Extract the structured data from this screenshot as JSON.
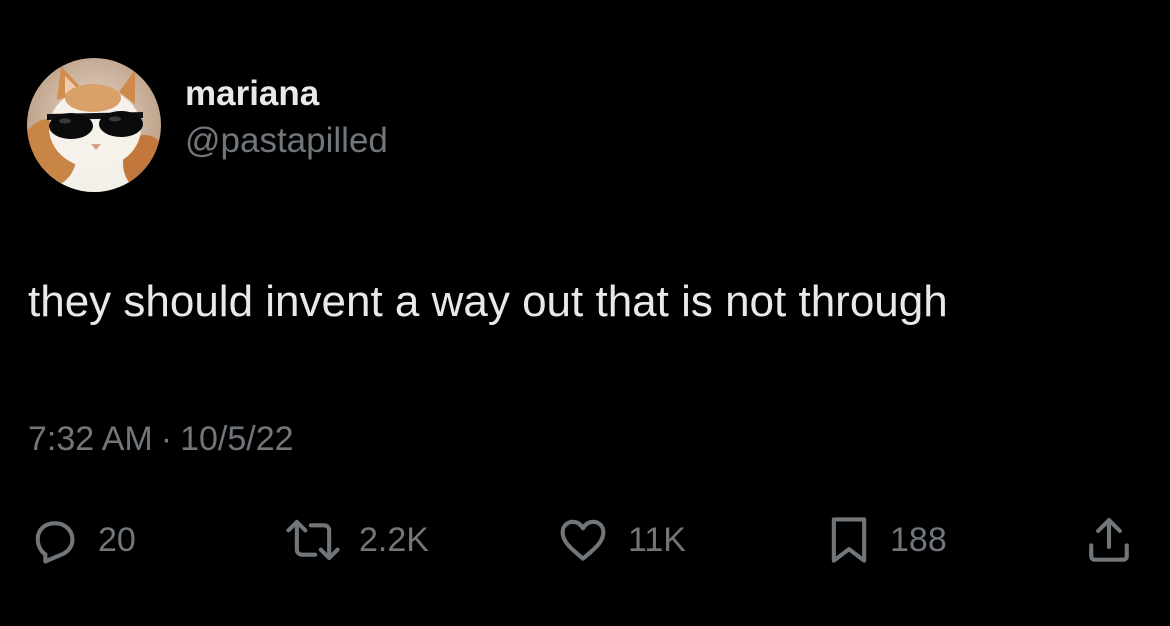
{
  "author": {
    "display_name": "mariana",
    "handle": "@pastapilled",
    "avatar_icon": "cat-with-sunglasses-avatar"
  },
  "tweet": {
    "text": "they should invent a way out that is not through",
    "time": "7:32 AM",
    "separator": "·",
    "date": "10/5/22"
  },
  "actions": {
    "reply": {
      "icon": "reply-icon",
      "count": "20"
    },
    "retweet": {
      "icon": "retweet-icon",
      "count": "2.2K"
    },
    "like": {
      "icon": "heart-icon",
      "count": "11K"
    },
    "bookmark": {
      "icon": "bookmark-icon",
      "count": "188"
    },
    "share": {
      "icon": "share-icon"
    }
  },
  "colors": {
    "background": "#000000",
    "primary_text": "#e7e9ea",
    "secondary_text": "#71767b"
  }
}
